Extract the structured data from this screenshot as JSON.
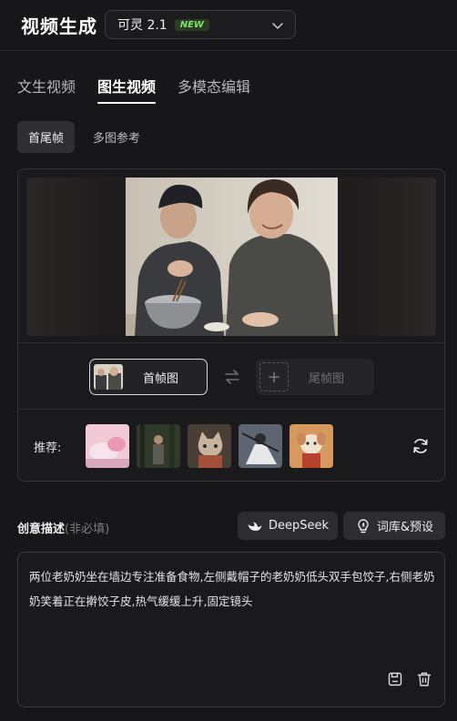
{
  "header": {
    "title": "视频生成",
    "model": {
      "name": "可灵 2.1",
      "badge": "NEW"
    }
  },
  "tabs": [
    {
      "label": "文生视频",
      "active": false
    },
    {
      "label": "图生视频",
      "active": true
    },
    {
      "label": "多模态编辑",
      "active": false
    }
  ],
  "subtabs": [
    {
      "label": "首尾帧",
      "active": true
    },
    {
      "label": "多图参考",
      "active": false
    }
  ],
  "frames": {
    "first_label": "首帧图",
    "last_label": "尾帧图",
    "add_symbol": "+"
  },
  "recommend": {
    "label": "推荐:",
    "thumbnails": [
      "pink-dessert",
      "forest-figure",
      "cat-portrait",
      "ink-warrior",
      "cute-dog"
    ]
  },
  "description": {
    "label": "创意描述",
    "hint": "(非必填)",
    "deepseek_label": "DeepSeek",
    "library_label": "词库&预设",
    "text": "两位老奶奶坐在墙边专注准备食物,左侧戴帽子的老奶奶低头双手包饺子,右侧老奶奶笑着正在擀饺子皮,热气缓缓上升,固定镜头"
  },
  "colors": {
    "background": "#17171a",
    "badge_green": "#7ee26a"
  }
}
